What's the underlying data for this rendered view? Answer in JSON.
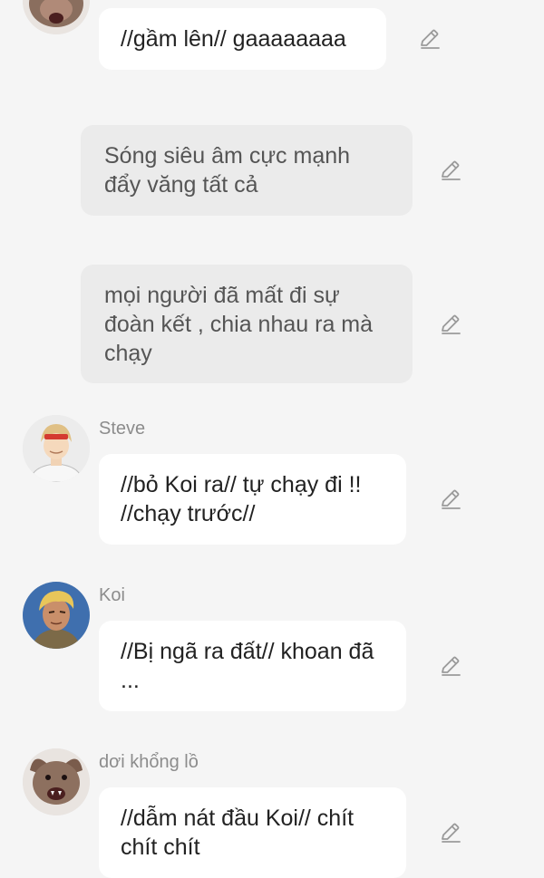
{
  "messages": [
    {
      "id": 1,
      "kind": "character",
      "speaker": "",
      "text": "//gầm lên// gaaaaaaaa",
      "avatar": "bat-avatar"
    },
    {
      "id": 2,
      "kind": "narration",
      "text": "Sóng siêu âm cực mạnh đẩy văng tất cả"
    },
    {
      "id": 3,
      "kind": "narration",
      "text": "mọi người đã mất đi sự đoàn kết , chia nhau ra mà chạy"
    },
    {
      "id": 4,
      "kind": "character",
      "speaker": "Steve",
      "text": "//bỏ Koi ra// tự chạy đi !! //chạy trước//",
      "avatar": "steve-avatar"
    },
    {
      "id": 5,
      "kind": "character",
      "speaker": "Koi",
      "text": "//Bị ngã ra đất// khoan đã ...",
      "avatar": "koi-avatar"
    },
    {
      "id": 6,
      "kind": "character",
      "speaker": "dơi khổng lồ",
      "text": "//dẫm nát đầu Koi// chít chít chít",
      "avatar": "bat-avatar"
    }
  ],
  "icons": {
    "edit": "pencil-icon"
  },
  "colors": {
    "background": "#f5f5f5",
    "bubble": "#ffffff",
    "narration_bubble": "#ebebeb",
    "speaker_name": "#8c8c8c",
    "icon": "#9a9a9a"
  }
}
